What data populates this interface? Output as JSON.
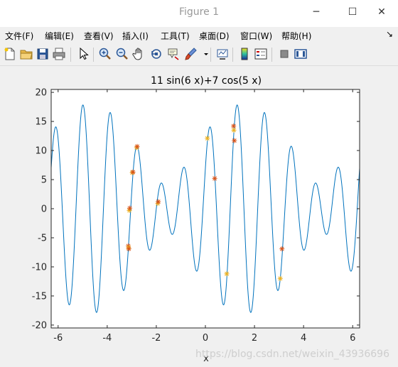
{
  "window": {
    "title": "Figure 1",
    "minimize_glyph": "─",
    "maximize_glyph": "☐",
    "close_glyph": "✕"
  },
  "menu": {
    "items": [
      "文件(F)",
      "编辑(E)",
      "查看(V)",
      "插入(I)",
      "工具(T)",
      "桌面(D)",
      "窗口(W)",
      "帮助(H)"
    ],
    "dock_glyph": "↘"
  },
  "toolbar": {
    "icons": [
      "new-figure-icon",
      "open-file-icon",
      "save-icon",
      "print-icon",
      "edit-plot-arrow-icon",
      "zoom-in-icon",
      "zoom-out-icon",
      "pan-hand-icon",
      "rotate-3d-icon",
      "data-cursor-icon",
      "brush-icon",
      "brush-dropdown-icon",
      "link-plot-icon",
      "insert-colorbar-icon",
      "insert-legend-icon",
      "hide-plot-tools-icon",
      "show-plot-tools-icon"
    ]
  },
  "watermark": "https://blog.csdn.net/weixin_43936696",
  "chart_data": {
    "type": "line",
    "title": "11 sin(6 x)+7 cos(5 x)",
    "xlabel": "x",
    "ylabel": "",
    "xlim": [
      -6.283,
      6.283
    ],
    "ylim": [
      -20.5,
      20.5
    ],
    "xticks": [
      -6,
      -4,
      -2,
      0,
      2,
      4,
      6
    ],
    "yticks": [
      -20,
      -15,
      -10,
      -5,
      0,
      5,
      10,
      15,
      20
    ],
    "grid": false,
    "series": [
      {
        "function": "11*sin(6*x)+7*cos(5*x)",
        "color": "#0072bd"
      }
    ],
    "markers": {
      "symbol": "*",
      "colors": [
        "#d95319",
        "#edb120"
      ],
      "points": [
        [
          -3.14,
          -6.4
        ],
        [
          -3.13,
          -6.7
        ],
        [
          -3.12,
          -6.9
        ],
        [
          -3.1,
          -0.3
        ],
        [
          -3.08,
          0.1
        ],
        [
          -2.98,
          6.2
        ],
        [
          -2.95,
          6.3
        ],
        [
          -2.8,
          10.5
        ],
        [
          -2.78,
          10.7
        ],
        [
          -1.94,
          0.9
        ],
        [
          -1.92,
          1.2
        ],
        [
          0.08,
          12.1
        ],
        [
          0.38,
          5.2
        ],
        [
          0.87,
          -11.2
        ],
        [
          1.15,
          14.2
        ],
        [
          1.16,
          13.5
        ],
        [
          1.18,
          11.7
        ],
        [
          3.05,
          -12.0
        ],
        [
          3.12,
          -6.9
        ]
      ]
    }
  }
}
